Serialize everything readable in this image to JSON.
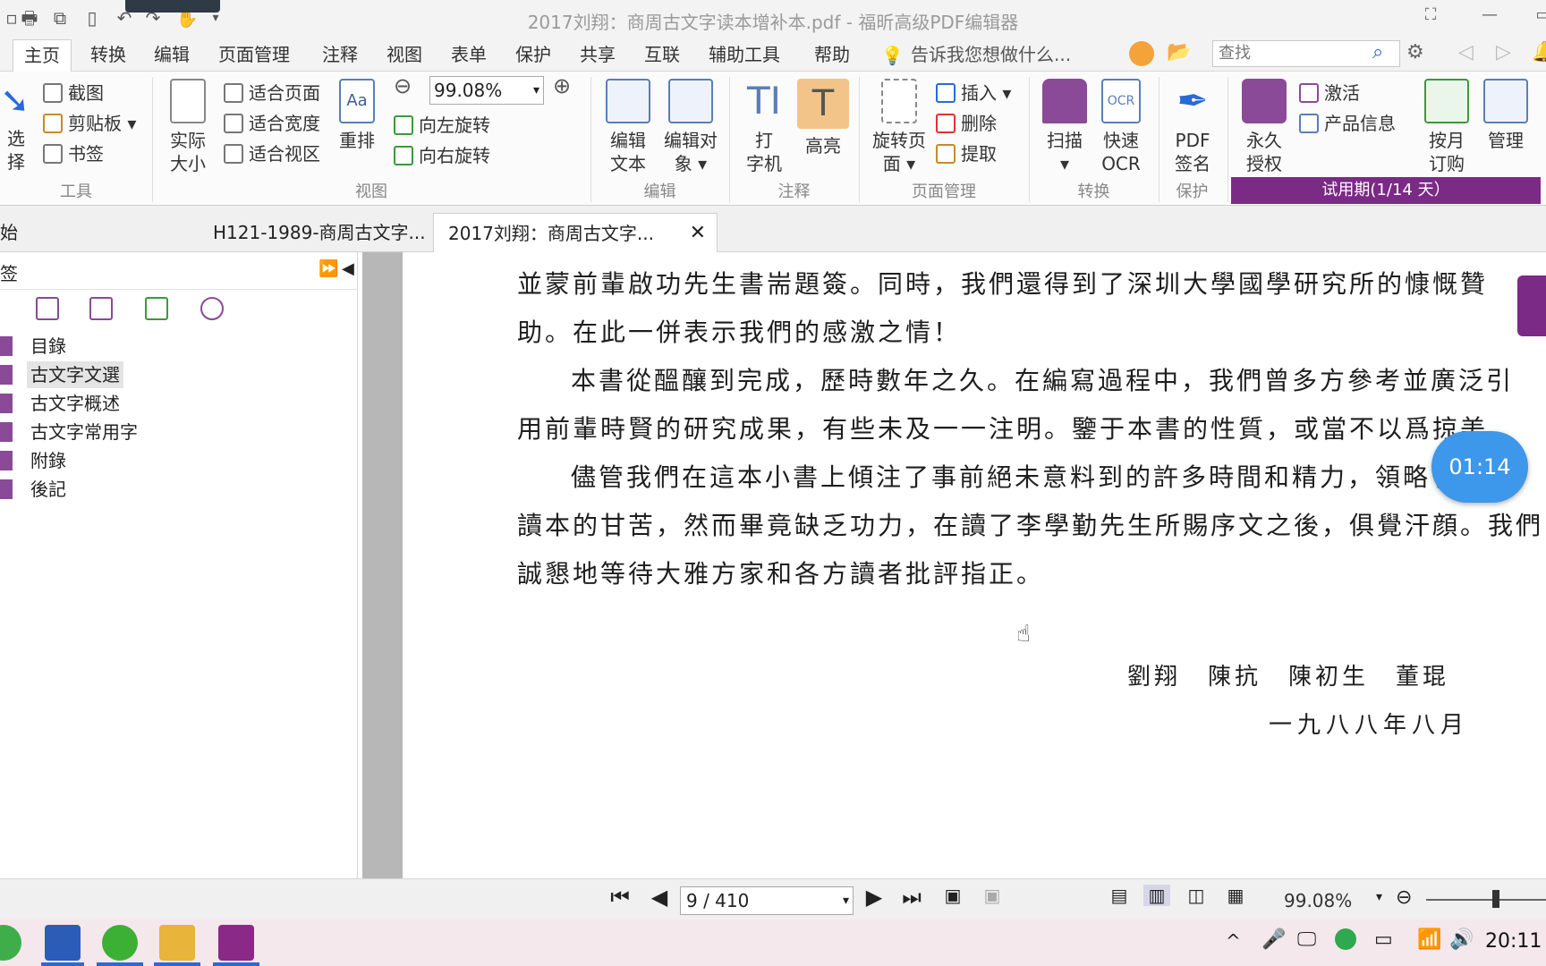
{
  "window": {
    "title": "2017刘翔：商周古文字读本增补本.pdf - 福昕高级PDF编辑器"
  },
  "menu": {
    "tabs": [
      "主页",
      "转换",
      "编辑",
      "页面管理",
      "注释",
      "视图",
      "表单",
      "保护",
      "共享",
      "互联",
      "辅助工具",
      "帮助"
    ],
    "tell_me": "告诉我您想做什么...",
    "search_placeholder": "查找"
  },
  "ribbon": {
    "select": "选择",
    "screenshot": "截图",
    "clipboard": "剪贴板",
    "bookmark": "书签",
    "actual_size_1": "实际",
    "actual_size_2": "大小",
    "fit_page": "适合页面",
    "fit_width": "适合宽度",
    "fit_view": "适合视区",
    "reflow": "重排",
    "zoom_value": "99.08%",
    "rotate_left": "向左旋转",
    "rotate_right": "向右旋转",
    "edit_text_1": "编辑",
    "edit_text_2": "文本",
    "edit_obj_1": "编辑对",
    "edit_obj_2": "象",
    "typewriter_1": "打",
    "typewriter_2": "字机",
    "highlight": "高亮",
    "rotate_page_1": "旋转页",
    "rotate_page_2": "面",
    "insert": "插入",
    "delete": "删除",
    "extract": "提取",
    "scan": "扫描",
    "ocr_1": "快速",
    "ocr_2": "OCR",
    "pdfsign_1": "PDF",
    "pdfsign_2": "签名",
    "perm_1": "永久",
    "perm_2": "授权",
    "activate": "激活",
    "product_info": "产品信息",
    "monthly_1": "按月",
    "monthly_2": "订购",
    "manage": "管理",
    "groups": {
      "tools": "工具",
      "view": "视图",
      "edit": "编辑",
      "comment": "注释",
      "pages": "页面管理",
      "convert": "转换",
      "protect": "保护"
    },
    "trial": "试用期(1/14 天）"
  },
  "doc_tabs": [
    {
      "label": "始"
    },
    {
      "label": "H121-1989-商周古文字..."
    },
    {
      "label": "2017刘翔：商周古文字..."
    }
  ],
  "left_panel": {
    "header": "签",
    "bookmarks": [
      "目錄",
      "古文字文選",
      "古文字概述",
      "古文字常用字",
      "附錄",
      "後記"
    ],
    "selected_index": 1
  },
  "document": {
    "lines": [
      "並蒙前輩啟功先生書耑題簽。同時，我們還得到了深圳大學國學研究所的慷慨贊",
      "助。在此一併表示我們的感激之情！",
      "本書從醞釀到完成，歷時數年之久。在編寫過程中，我們曾多方參考並廣泛引",
      "用前輩時賢的研究成果，有些未及一一注明。鑒于本書的性質，或當不以爲掠美",
      "儘管我們在這本小書上傾注了事前絕未意料到的許多時間和精力，領略了編寫",
      "讀本的甘苦，然而畢竟缺乏功力，在讀了李學勤先生所賜序文之後，俱覺汗顔。我們",
      "誠懇地等待大雅方家和各方讀者批評指正。"
    ],
    "authors": "劉翔　陳抗　陳初生　董琨",
    "date": "一九八八年八月"
  },
  "timer": "01:14",
  "status": {
    "page": "9 / 410",
    "zoom": "99.08%"
  },
  "taskbar": {
    "clock": "20:11"
  }
}
